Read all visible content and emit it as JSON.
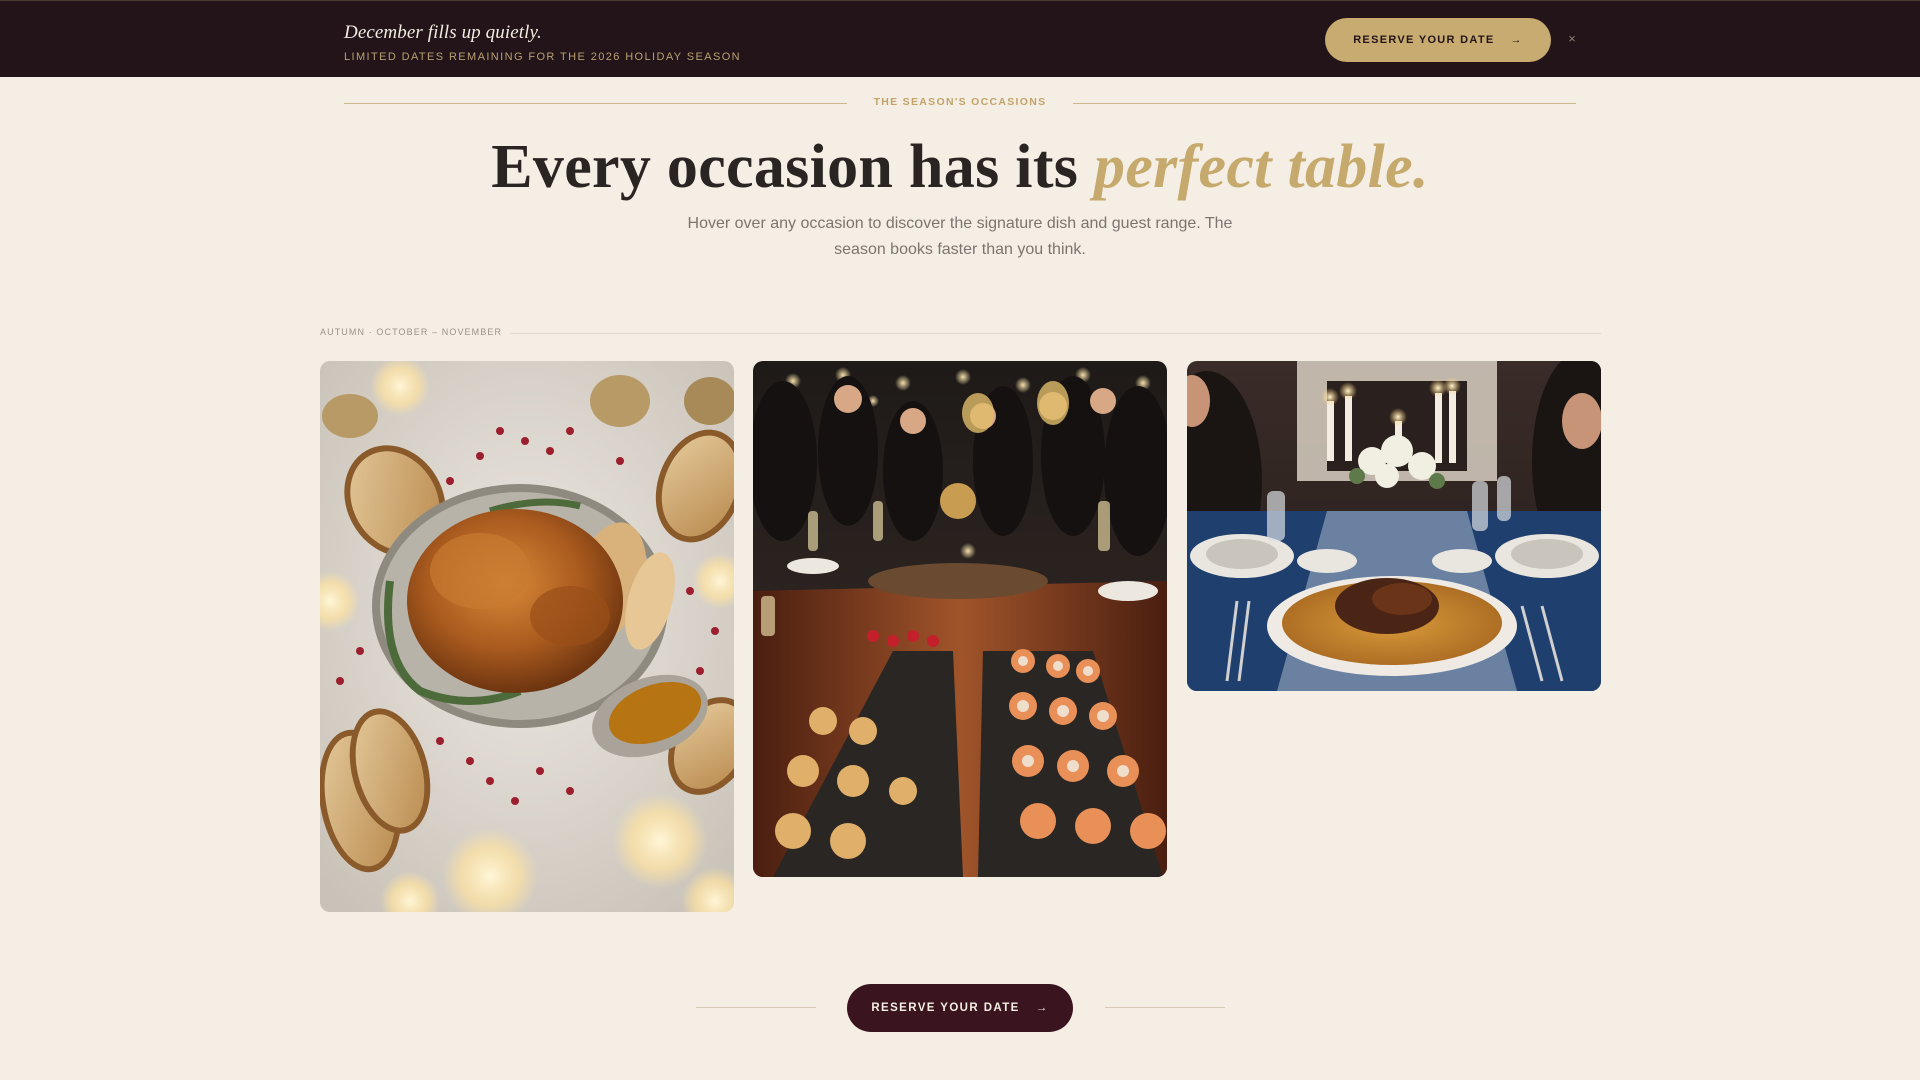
{
  "banner": {
    "title": "December fills up quietly.",
    "subtitle": "LIMITED DATES REMAINING FOR THE 2026 HOLIDAY SEASON",
    "cta_label": "RESERVE YOUR DATE",
    "cta_arrow": "→",
    "close_symbol": "×"
  },
  "header": {
    "eyebrow": "THE SEASON'S OCCASIONS",
    "headline_main": "Every occasion has its ",
    "headline_accent": "perfect table.",
    "lede": "Hover over any occasion to discover the signature dish and guest range. The season books faster than you think."
  },
  "season": {
    "label": "AUTUMN · OCTOBER – NOVEMBER"
  },
  "cards": [
    {
      "image": "roast-turkey-with-bread-and-cranberries"
    },
    {
      "image": "cocktail-party-canape-table"
    },
    {
      "image": "candlelit-dinner-with-braised-short-ribs"
    }
  ],
  "footer_cta": {
    "label": "RESERVE YOUR DATE",
    "arrow": "→"
  },
  "colors": {
    "background": "#f4eee4",
    "banner": "#221419",
    "gold": "#c8ab70",
    "burgundy": "#3a1520",
    "text": "#2a2523",
    "muted": "#7d7470"
  }
}
